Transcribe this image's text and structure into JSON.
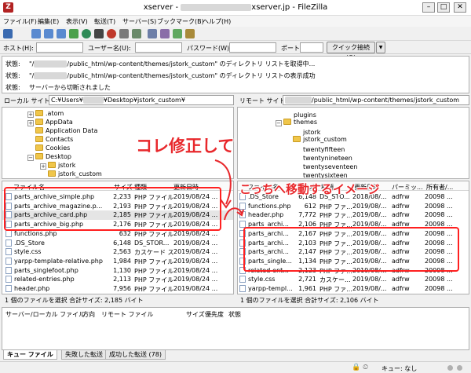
{
  "window": {
    "title_prefix": "xserver - ",
    "title_suffix": "xserver.jp - FileZilla",
    "minimize": "–",
    "maximize": "□",
    "close": "✕"
  },
  "menu": [
    "ファイル(F)",
    "編集(E)",
    "表示(V)",
    "転送(T)",
    "サーバー(S)",
    "ブックマーク(B)",
    "ヘルプ(H)"
  ],
  "quickconnect": {
    "host_label": "ホスト(H):",
    "user_label": "ユーザー名(U):",
    "pass_label": "パスワード(W):",
    "port_label": "ポート(P):",
    "button": "クイック接続(Q)",
    "dropdown": "▼"
  },
  "log": [
    {
      "label": "状態:",
      "path": "\"/",
      "path_tail": "/public_html/wp-content/themes/jstork_custom\" のディレクトリ リストを取得中..."
    },
    {
      "label": "状態:",
      "path": "\"/",
      "path_tail": "/public_html/wp-content/themes/jstork_custom\" のディレクトリ リストの表示成功"
    },
    {
      "label": "状態:",
      "path": "",
      "path_tail": "サーバーから切断されました"
    }
  ],
  "local": {
    "site_label": "ローカル サイト:",
    "site_path_head": "C:¥Users¥",
    "site_path_tail": "¥Desktop¥jstork_custom¥",
    "tree": [
      {
        "name": ".atom",
        "indent": 2,
        "expand": "+"
      },
      {
        "name": "AppData",
        "indent": 2,
        "expand": "+"
      },
      {
        "name": "Application Data",
        "indent": 2,
        "expand": ""
      },
      {
        "name": "Contacts",
        "indent": 2,
        "expand": ""
      },
      {
        "name": "Cookies",
        "indent": 2,
        "expand": ""
      },
      {
        "name": "Desktop",
        "indent": 2,
        "expand": "−"
      },
      {
        "name": "jstork",
        "indent": 3,
        "expand": "+"
      },
      {
        "name": "jstork_custom",
        "indent": 3,
        "expand": ""
      }
    ],
    "headers": {
      "name": "ファイル名",
      "size": "サイズ",
      "type": "種類",
      "modified": "更新日時"
    },
    "files": [
      {
        "name": "parts_archive_simple.php",
        "size": "2,233",
        "type": "PHP ファイル",
        "modified": "2019/08/24 ..."
      },
      {
        "name": "parts_archive_magazine.p...",
        "size": "2,193",
        "type": "PHP ファイル",
        "modified": "2019/08/24 ..."
      },
      {
        "name": "parts_archive_card.php",
        "size": "2,185",
        "type": "PHP ファイル",
        "modified": "2019/08/24 ..."
      },
      {
        "name": "parts_archive_big.php",
        "size": "2,176",
        "type": "PHP ファイル",
        "modified": "2019/08/24 ..."
      },
      {
        "name": "functions.php",
        "size": "632",
        "type": "PHP ファイル",
        "modified": "2019/08/24 ..."
      },
      {
        "name": ".DS_Store",
        "size": "6,148",
        "type": "DS_STOR...",
        "modified": "2019/08/24 ..."
      },
      {
        "name": "style.css",
        "size": "2,563",
        "type": "カスケード スタ...",
        "modified": "2019/08/24 ..."
      },
      {
        "name": "yarpp-template-relative.php",
        "size": "1,984",
        "type": "PHP ファイル",
        "modified": "2019/08/24 ..."
      },
      {
        "name": "parts_singlefoot.php",
        "size": "1,130",
        "type": "PHP ファイル",
        "modified": "2019/08/24 ..."
      },
      {
        "name": "related-entries.php",
        "size": "2,113",
        "type": "PHP ファイル",
        "modified": "2019/08/24 ..."
      },
      {
        "name": "header.php",
        "size": "7,956",
        "type": "PHP ファイル",
        "modified": "2019/08/24 ..."
      }
    ],
    "status": "1 個のファイルを選択 合計サイズ: 2,185 バイト"
  },
  "remote": {
    "site_label": "リモート サイト:",
    "site_path_tail": "/public_html/wp-content/themes/jstork_custom",
    "tree": [
      {
        "name": "plugins",
        "indent": 4,
        "icon": "q",
        "expand": ""
      },
      {
        "name": "themes",
        "indent": 4,
        "icon": "f",
        "expand": "−"
      },
      {
        "name": "jstork",
        "indent": 5,
        "icon": "q",
        "expand": ""
      },
      {
        "name": "jstork_custom",
        "indent": 5,
        "icon": "f",
        "expand": ""
      },
      {
        "name": "twentyfifteen",
        "indent": 5,
        "icon": "q",
        "expand": ""
      },
      {
        "name": "twentynineteen",
        "indent": 5,
        "icon": "q",
        "expand": ""
      },
      {
        "name": "twentyseventeen",
        "indent": 5,
        "icon": "q",
        "expand": ""
      },
      {
        "name": "twentysixteen",
        "indent": 5,
        "icon": "q",
        "expand": ""
      }
    ],
    "headers": {
      "name": "ファイル名",
      "size": "サイズ",
      "type": "種類",
      "modified": "更新日時",
      "perm": "パーミッ...",
      "owner": "所有者/..."
    },
    "files": [
      {
        "name": ".DS_Store",
        "size": "6,148",
        "type": "DS_STO...",
        "modified": "2018/08/...",
        "perm": "adfrw",
        "owner": "20098 ..."
      },
      {
        "name": "functions.php",
        "size": "612",
        "type": "PHP ファ...",
        "modified": "2019/08/...",
        "perm": "adfrw",
        "owner": "20098 ..."
      },
      {
        "name": "header.php",
        "size": "7,772",
        "type": "PHP ファ...",
        "modified": "2019/08/...",
        "perm": "adfrw",
        "owner": "20098 ..."
      },
      {
        "name": "parts_archi...",
        "size": "2,106",
        "type": "PHP ファ...",
        "modified": "2019/08/...",
        "perm": "adfrw",
        "owner": "20098 ..."
      },
      {
        "name": "parts_archi...",
        "size": "2,167",
        "type": "PHP ファ...",
        "modified": "2019/08/...",
        "perm": "adfrw",
        "owner": "20098 ..."
      },
      {
        "name": "parts_archi...",
        "size": "2,103",
        "type": "PHP ファ...",
        "modified": "2019/08/...",
        "perm": "adfrw",
        "owner": "20098 ..."
      },
      {
        "name": "parts_archi...",
        "size": "2,147",
        "type": "PHP ファ...",
        "modified": "2019/08/...",
        "perm": "adfrw",
        "owner": "20098 ..."
      },
      {
        "name": "parts_single...",
        "size": "1,134",
        "type": "PHP ファ...",
        "modified": "2019/08/...",
        "perm": "adfrw",
        "owner": "20098 ..."
      },
      {
        "name": "related-ent...",
        "size": "2,123",
        "type": "PHP ファ...",
        "modified": "2019/08/...",
        "perm": "adfrw",
        "owner": "20098 ..."
      },
      {
        "name": "style.css",
        "size": "2,721",
        "type": "カスケー...",
        "modified": "2019/08/...",
        "perm": "adfrw",
        "owner": "20098 ..."
      },
      {
        "name": "yarpp-templ...",
        "size": "1,961",
        "type": "PHP ファ...",
        "modified": "2019/08/...",
        "perm": "adfrw",
        "owner": "20098 ..."
      }
    ],
    "status": "1 個のファイルを選択 合計サイズ: 2,106 バイト"
  },
  "queue": {
    "headers": [
      "サーバー/ローカル ファイル",
      "方向",
      "リモート ファイル",
      "サイズ",
      "優先度",
      "状態"
    ],
    "tabs": [
      "キュー ファイル",
      "失敗した転送",
      "成功した転送 (78)"
    ]
  },
  "statusbar": {
    "queue": "キュー: なし"
  },
  "annotations": {
    "left_note": "コレ修正して",
    "right_note": "こっちへ移動するイメージ"
  },
  "colors": {
    "annotation": "#e8282c"
  }
}
